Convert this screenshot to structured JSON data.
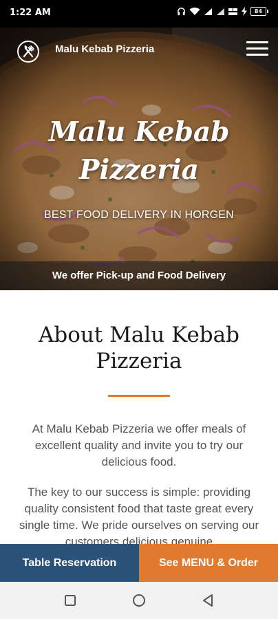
{
  "status_bar": {
    "time": "1:22 AM",
    "battery_level": "84",
    "icons": [
      "headphones-icon",
      "wifi-icon",
      "signal-icon",
      "signal-icon",
      "volte-icon",
      "charging-icon",
      "battery-icon"
    ]
  },
  "header": {
    "site_name": "Malu Kebab Pizzeria",
    "logo_icon": "fork-knife-icon",
    "menu_icon": "hamburger-menu-icon"
  },
  "hero": {
    "title_line1": "Malu Kebab",
    "title_line2": "Pizzeria",
    "subtitle": "BEST FOOD DELIVERY IN HORGEN",
    "banner": "We offer Pick-up and Food Delivery"
  },
  "about": {
    "title_line1": "About Malu Kebab",
    "title_line2": "Pizzeria",
    "accent_color": "#e0772e",
    "paragraph1": "At Malu Kebab Pizzeria we offer meals of excellent quality and invite you to try our delicious food.",
    "paragraph2": "The key to our success is simple: providing quality consistent food that taste great every single time. We pride ourselves on serving our customers delicious genuine"
  },
  "actions": {
    "reserve_label": "Table Reservation",
    "reserve_color": "#2b5278",
    "order_label": "See MENU & Order",
    "order_color": "#e07a2f"
  },
  "nav": {
    "icons": [
      "recent-apps-icon",
      "home-icon",
      "back-icon"
    ]
  }
}
